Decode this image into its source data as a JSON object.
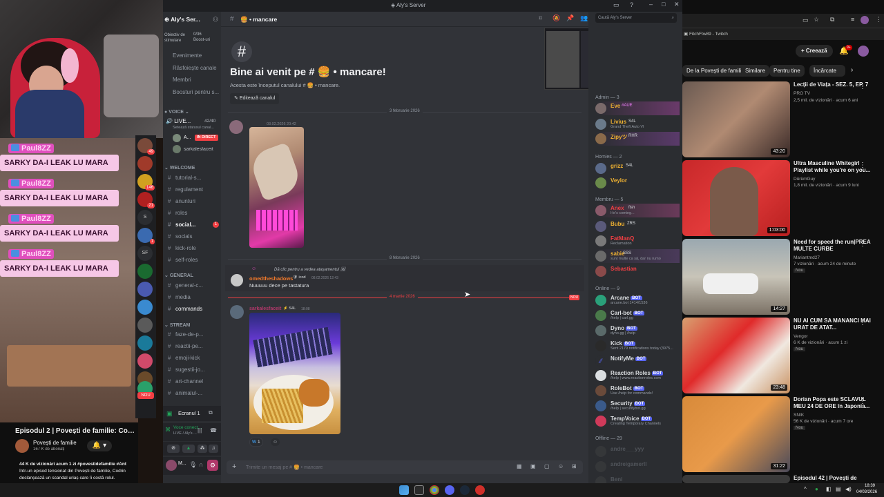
{
  "stream_overlay": {
    "chat": [
      {
        "user": "Paul8ZZ",
        "message": "SARKY DA-I LEAK LU MARA"
      },
      {
        "user": "Paul8ZZ",
        "message": "SARKY DA-I LEAK LU MARA"
      },
      {
        "user": "Paul8ZZ",
        "message": "SARKY DA-I LEAK LU MARA"
      },
      {
        "user": "Paul8ZZ",
        "message": "SARKY DA-I LEAK LU MARA"
      }
    ],
    "youtube_video_title": "Episodul 2 | Povești de familie: Codrin",
    "youtube_channel": "Povești de familie",
    "youtube_subs": "167 K de abonați",
    "youtube_views": "44 K de vizionări  acum 1 zi  #povestidefamilie #Ant",
    "youtube_desc_1": "Într-un episod tensionat din Povești de familie, Codrin",
    "youtube_desc_2": "declanșează un scandal uriaș   care îi costă rolul."
  },
  "guild_rail": {
    "badges": [
      "49",
      "146",
      "21",
      "1"
    ],
    "nou_label": "NOU"
  },
  "discord": {
    "window_title": "Aly's Server",
    "server_name": "Aly's Ser...",
    "boost_goal": "Obiectiv de stimulare",
    "boost_count": "0/36",
    "boost_label": "Boost-uri",
    "menu": [
      "Evenimente",
      "Răsfoiește canale",
      "Membri",
      "Boosturi pentru s..."
    ],
    "voice_category": "VOICE",
    "live_channel": "LIVE...",
    "live_count": "42/40",
    "live_status": "Setează statusul canal...",
    "live_user": "A...",
    "live_badge": "IN DIRECT",
    "voice_user2": "sarkalesfaceit",
    "welcome_category": "WELCOME",
    "welcome_channels": [
      "tutorial-s...",
      "regulament",
      "anunturi",
      "roles",
      "social...",
      "socials",
      "kick-role",
      "self-roles"
    ],
    "social_badge": "1",
    "general_category": "GENERAL",
    "general_channels": [
      "general-c...",
      "media",
      "commands"
    ],
    "stream_category": "STREAM",
    "stream_channels": [
      "faze-de-p...",
      "reactii-pe...",
      "emoji-kick",
      "sugestii-jo...",
      "art-channel",
      "animalul-..."
    ],
    "screen_share": "Ecranul 1",
    "voice_connected": "Voce conectată",
    "voice_connected_sub": "LIVE / Aly's ...",
    "user_short": "M...",
    "channel_name": "mancare",
    "search_placeholder": "Caută Aly's Server",
    "welcome_title": "Bine ai venit pe #",
    "welcome_title_end": "mancare!",
    "welcome_sub": "Acesta este începutul canalului #",
    "welcome_sub_end": "mancare.",
    "edit_channel": "Editează canalul",
    "date1": "3 februarie 2026",
    "msg1_time": "03.02.2026 20:42",
    "date2": "8 februarie 2026",
    "reply_hint": "Dă clic pentru a vedea atașamentul",
    "msg2_user": "omedtheshadows",
    "msg2_tag": "icod",
    "msg2_time": "08.02.2026 12:43",
    "msg2_text": "Nuuuuu dece pe tastatura",
    "date3": "4 martie 2026",
    "new_label": "NOU",
    "msg3_user": "sarkalesfaceit",
    "msg3_tag": "S4L",
    "msg3_time": "18:08",
    "reaction_count": "1",
    "input_placeholder": "Trimite un mesaj pe #",
    "input_placeholder_end": "mancare"
  },
  "members": {
    "admin_header": "Admin — 3",
    "admins": [
      {
        "name": "Eve",
        "tag": "#AUE",
        "status": "",
        "color": "#f0b232"
      },
      {
        "name": "Livius",
        "tag": "S4L",
        "status": "Grand Theft Auto VI",
        "color": "#f0b232"
      },
      {
        "name": "Zipyツ",
        "tag": "RHR",
        "status": "",
        "color": "#f0b232"
      }
    ],
    "homies_header": "Homies — 2",
    "homies": [
      {
        "name": "grizz",
        "tag": "S4L",
        "color": "#f0b232"
      },
      {
        "name": "Veylor",
        "tag": "",
        "color": "#f0b232"
      }
    ],
    "membru_header": "Membru — 5",
    "membru": [
      {
        "name": "Anex",
        "tag": "fish",
        "status": "He's coming...",
        "color": "#f23f43"
      },
      {
        "name": "Bubu",
        "tag": "ZRS",
        "status": "",
        "color": "#f0b232"
      },
      {
        "name": "FatManQ",
        "tag": "",
        "status": "Reclamation",
        "color": "#f23f43"
      },
      {
        "name": "sabie",
        "tag": "SSS",
        "status": "sunt multe ca să, dar nu rumo",
        "color": "#f0b232"
      },
      {
        "name": "Sebastian",
        "tag": "",
        "status": "",
        "color": "#f23f43"
      }
    ],
    "online_header": "Online — 9",
    "bots": [
      {
        "name": "Arcane",
        "status": "arcane.bot 1414/1536"
      },
      {
        "name": "Carl-bot",
        "status": "/help | carl.gg"
      },
      {
        "name": "Dyno",
        "status": "dyno.gg | /help"
      },
      {
        "name": "Kick",
        "status": "Sent 2179 notifications today (3975..."
      },
      {
        "name": "NotifyMe",
        "status": ""
      },
      {
        "name": "Reaction Roles",
        "status": "/help | www.reactionroles.com"
      },
      {
        "name": "RoleBot",
        "status": "Use /help for commands!"
      },
      {
        "name": "Security",
        "status": "/help | securitybot.gg"
      },
      {
        "name": "TempVoice",
        "status": "Creating Temporary Channels"
      }
    ],
    "bot_tag": "BOT",
    "offline_header": "Offline — 29",
    "offline": [
      "andre___yyy",
      "andreigamerll",
      "Beni"
    ]
  },
  "youtube": {
    "tab_title": "FitchFtw89 - Twitch",
    "create_label": "Creează",
    "notif_count": "9+",
    "chips": [
      "De la Povești de familie",
      "Similare",
      "Pentru tine",
      "Încărcate rece"
    ],
    "videos": [
      {
        "title": "Lecții de Viața - SEZ. 5, EP. 7",
        "channel": "PRO TV",
        "meta": "2,5 mil. de vizionări · acum 6 ani",
        "dur": "43:20",
        "nou": ""
      },
      {
        "title": "Ultra Masculine Whitegirl Playlist while you're on you...",
        "channel": "DürümGuy",
        "meta": "1,8 mil. de vizionări · acum 9 luni",
        "dur": "1:03:00",
        "nou": ""
      },
      {
        "title": "Need for speed the run|PREA MULTE CURBE",
        "channel": "Mariantmd27",
        "meta": "7 vizionări · acum 24 de minute",
        "dur": "14:27",
        "nou": "Nou"
      },
      {
        "title": "NU AI CUM SA MANANCI MAI URAT DE ATAT...",
        "channel": "Vengor",
        "meta": "6 K de vizionări · acum 1 zi",
        "dur": "23:48",
        "nou": "Nou"
      },
      {
        "title": "Dorian Popa este SCLAVUL MEU 24 DE ORE în Japonia...",
        "channel": "SNIK",
        "meta": "56 K de vizionări · acum 7 ore",
        "dur": "31:22",
        "nou": "Nou"
      },
      {
        "title": "Episodul 42 | Povești de",
        "channel": "",
        "meta": "",
        "dur": "",
        "nou": ""
      }
    ]
  },
  "taskbar": {
    "time": "18:39",
    "date": "04/03/2026"
  }
}
